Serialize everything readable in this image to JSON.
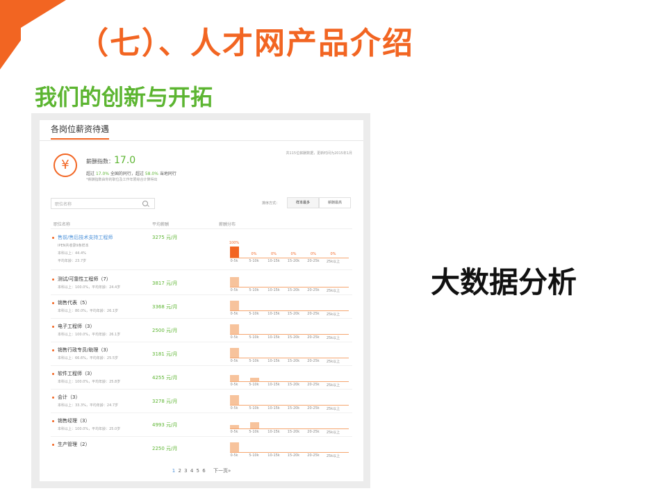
{
  "slide": {
    "title": "（七）、人才网产品介绍",
    "subtitle": "我们的创新与开拓",
    "side_text": "大数据分析",
    "accent_color": "#f26522",
    "green_color": "#5cb531"
  },
  "panel": {
    "title": "各岗位薪资待遇",
    "salary_icon": "yen-icon",
    "index_label": "薪酬指数：",
    "index_value": "17.0",
    "exceed_prefix": "超过",
    "exceed_national_pct": "17.0%",
    "exceed_national_text": "全国的同行，超过",
    "exceed_local_pct": "58.0%",
    "exceed_local_text": "当地同行",
    "note": "*薪酬指数由你的职位及工作年限综合计算得出",
    "source_note": "共115位薪酬数据，更新时间为2015年1月",
    "search_placeholder": "职位名称",
    "sort_label": "排序方式：",
    "sort_tabs": [
      "样本最多",
      "薪酬最高"
    ],
    "col_headers": [
      "职位名称",
      "平均薪酬",
      "薪酬分布"
    ],
    "bins": [
      "0-5k",
      "5-10k",
      "10-15k",
      "15-20k",
      "20-25k",
      "25k以上"
    ],
    "first_pct_labels": [
      "100%",
      "0%",
      "0%",
      "0%",
      "0%",
      "0%"
    ],
    "jobs": [
      {
        "title": "售前/售后技术支持工程师",
        "meta": "",
        "extra1": "IPEN共收录9条样本",
        "extra2": "本科以上：44.4%",
        "extra3": "平均年龄：23.7岁",
        "salary": "3275 元/月",
        "dist": [
          1,
          0,
          0,
          0,
          0,
          0
        ]
      },
      {
        "title": "测试/可靠性工程师（7）",
        "meta": "本科以上：100.0%，平均年龄：24.4岁",
        "salary": "3817 元/月",
        "dist": [
          1,
          0,
          0,
          0,
          0,
          0
        ]
      },
      {
        "title": "销售代表（5）",
        "meta": "本科以上：80.0%，平均年龄：26.1岁",
        "salary": "3368 元/月",
        "dist": [
          1,
          0,
          0,
          0,
          0,
          0
        ]
      },
      {
        "title": "电子工程师（3）",
        "meta": "本科以上：100.0%，平均年龄：26.1岁",
        "salary": "2500 元/月",
        "dist": [
          1,
          0,
          0,
          0,
          0,
          0
        ]
      },
      {
        "title": "销售行政专员/助理（3）",
        "meta": "本科以上：66.6%，平均年龄：25.5岁",
        "salary": "3181 元/月",
        "dist": [
          1,
          0,
          0,
          0,
          0,
          0
        ]
      },
      {
        "title": "软件工程师（3）",
        "meta": "本科以上：100.0%，平均年龄：25.8岁",
        "salary": "4255 元/月",
        "dist": [
          0.67,
          0.33,
          0,
          0,
          0,
          0
        ]
      },
      {
        "title": "会计（3）",
        "meta": "本科以上：33.3%，平均年龄：24.7岁",
        "salary": "3278 元/月",
        "dist": [
          1,
          0,
          0,
          0,
          0,
          0
        ]
      },
      {
        "title": "销售经理（3）",
        "meta": "本科以上：100.0%，平均年龄：25.0岁",
        "salary": "4993 元/月",
        "dist": [
          0.33,
          0.67,
          0,
          0,
          0,
          0
        ]
      },
      {
        "title": "生产管理（2）",
        "meta": "",
        "salary": "2250 元/月",
        "dist": [
          1,
          0,
          0,
          0,
          0,
          0
        ]
      }
    ],
    "pagination": {
      "pages": [
        "1",
        "2",
        "3",
        "4",
        "5",
        "6"
      ],
      "current": "1",
      "next": "下一页»"
    }
  }
}
